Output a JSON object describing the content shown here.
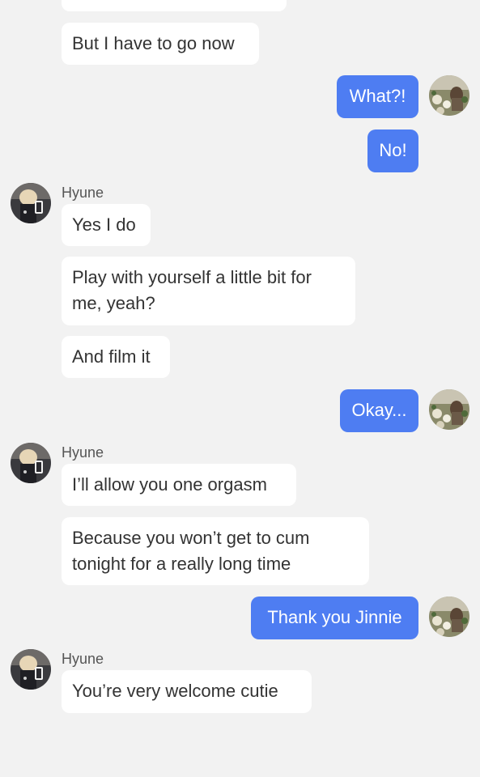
{
  "contact": {
    "name": "Hyune"
  },
  "messages": [
    {
      "id": "m0",
      "side": "in",
      "text": ""
    },
    {
      "id": "m1",
      "side": "in",
      "text": "But I have to go now"
    },
    {
      "id": "m2",
      "side": "out",
      "text": "What?!"
    },
    {
      "id": "m3",
      "side": "out",
      "text": "No!"
    },
    {
      "id": "m4",
      "side": "in",
      "sender": "Hyune",
      "text": "Yes I do"
    },
    {
      "id": "m5",
      "side": "in",
      "text": "Play with yourself a little bit for\nme, yeah?"
    },
    {
      "id": "m6",
      "side": "in",
      "text": "And film it"
    },
    {
      "id": "m7",
      "side": "out",
      "text": "Okay..."
    },
    {
      "id": "m8",
      "side": "in",
      "sender": "Hyune",
      "text": "I’ll allow you one orgasm"
    },
    {
      "id": "m9",
      "side": "in",
      "text": "Because you won’t get to cum\ntonight for a really long time"
    },
    {
      "id": "m10",
      "side": "out",
      "text": "Thank you Jinnie"
    },
    {
      "id": "m11",
      "side": "in",
      "sender": "Hyune",
      "text": "You’re very welcome cutie"
    }
  ],
  "colors": {
    "background": "#f2f2f2",
    "incoming_bubble": "#ffffff",
    "outgoing_bubble": "#4e7df2",
    "incoming_text": "#333333",
    "outgoing_text": "#ffffff"
  }
}
